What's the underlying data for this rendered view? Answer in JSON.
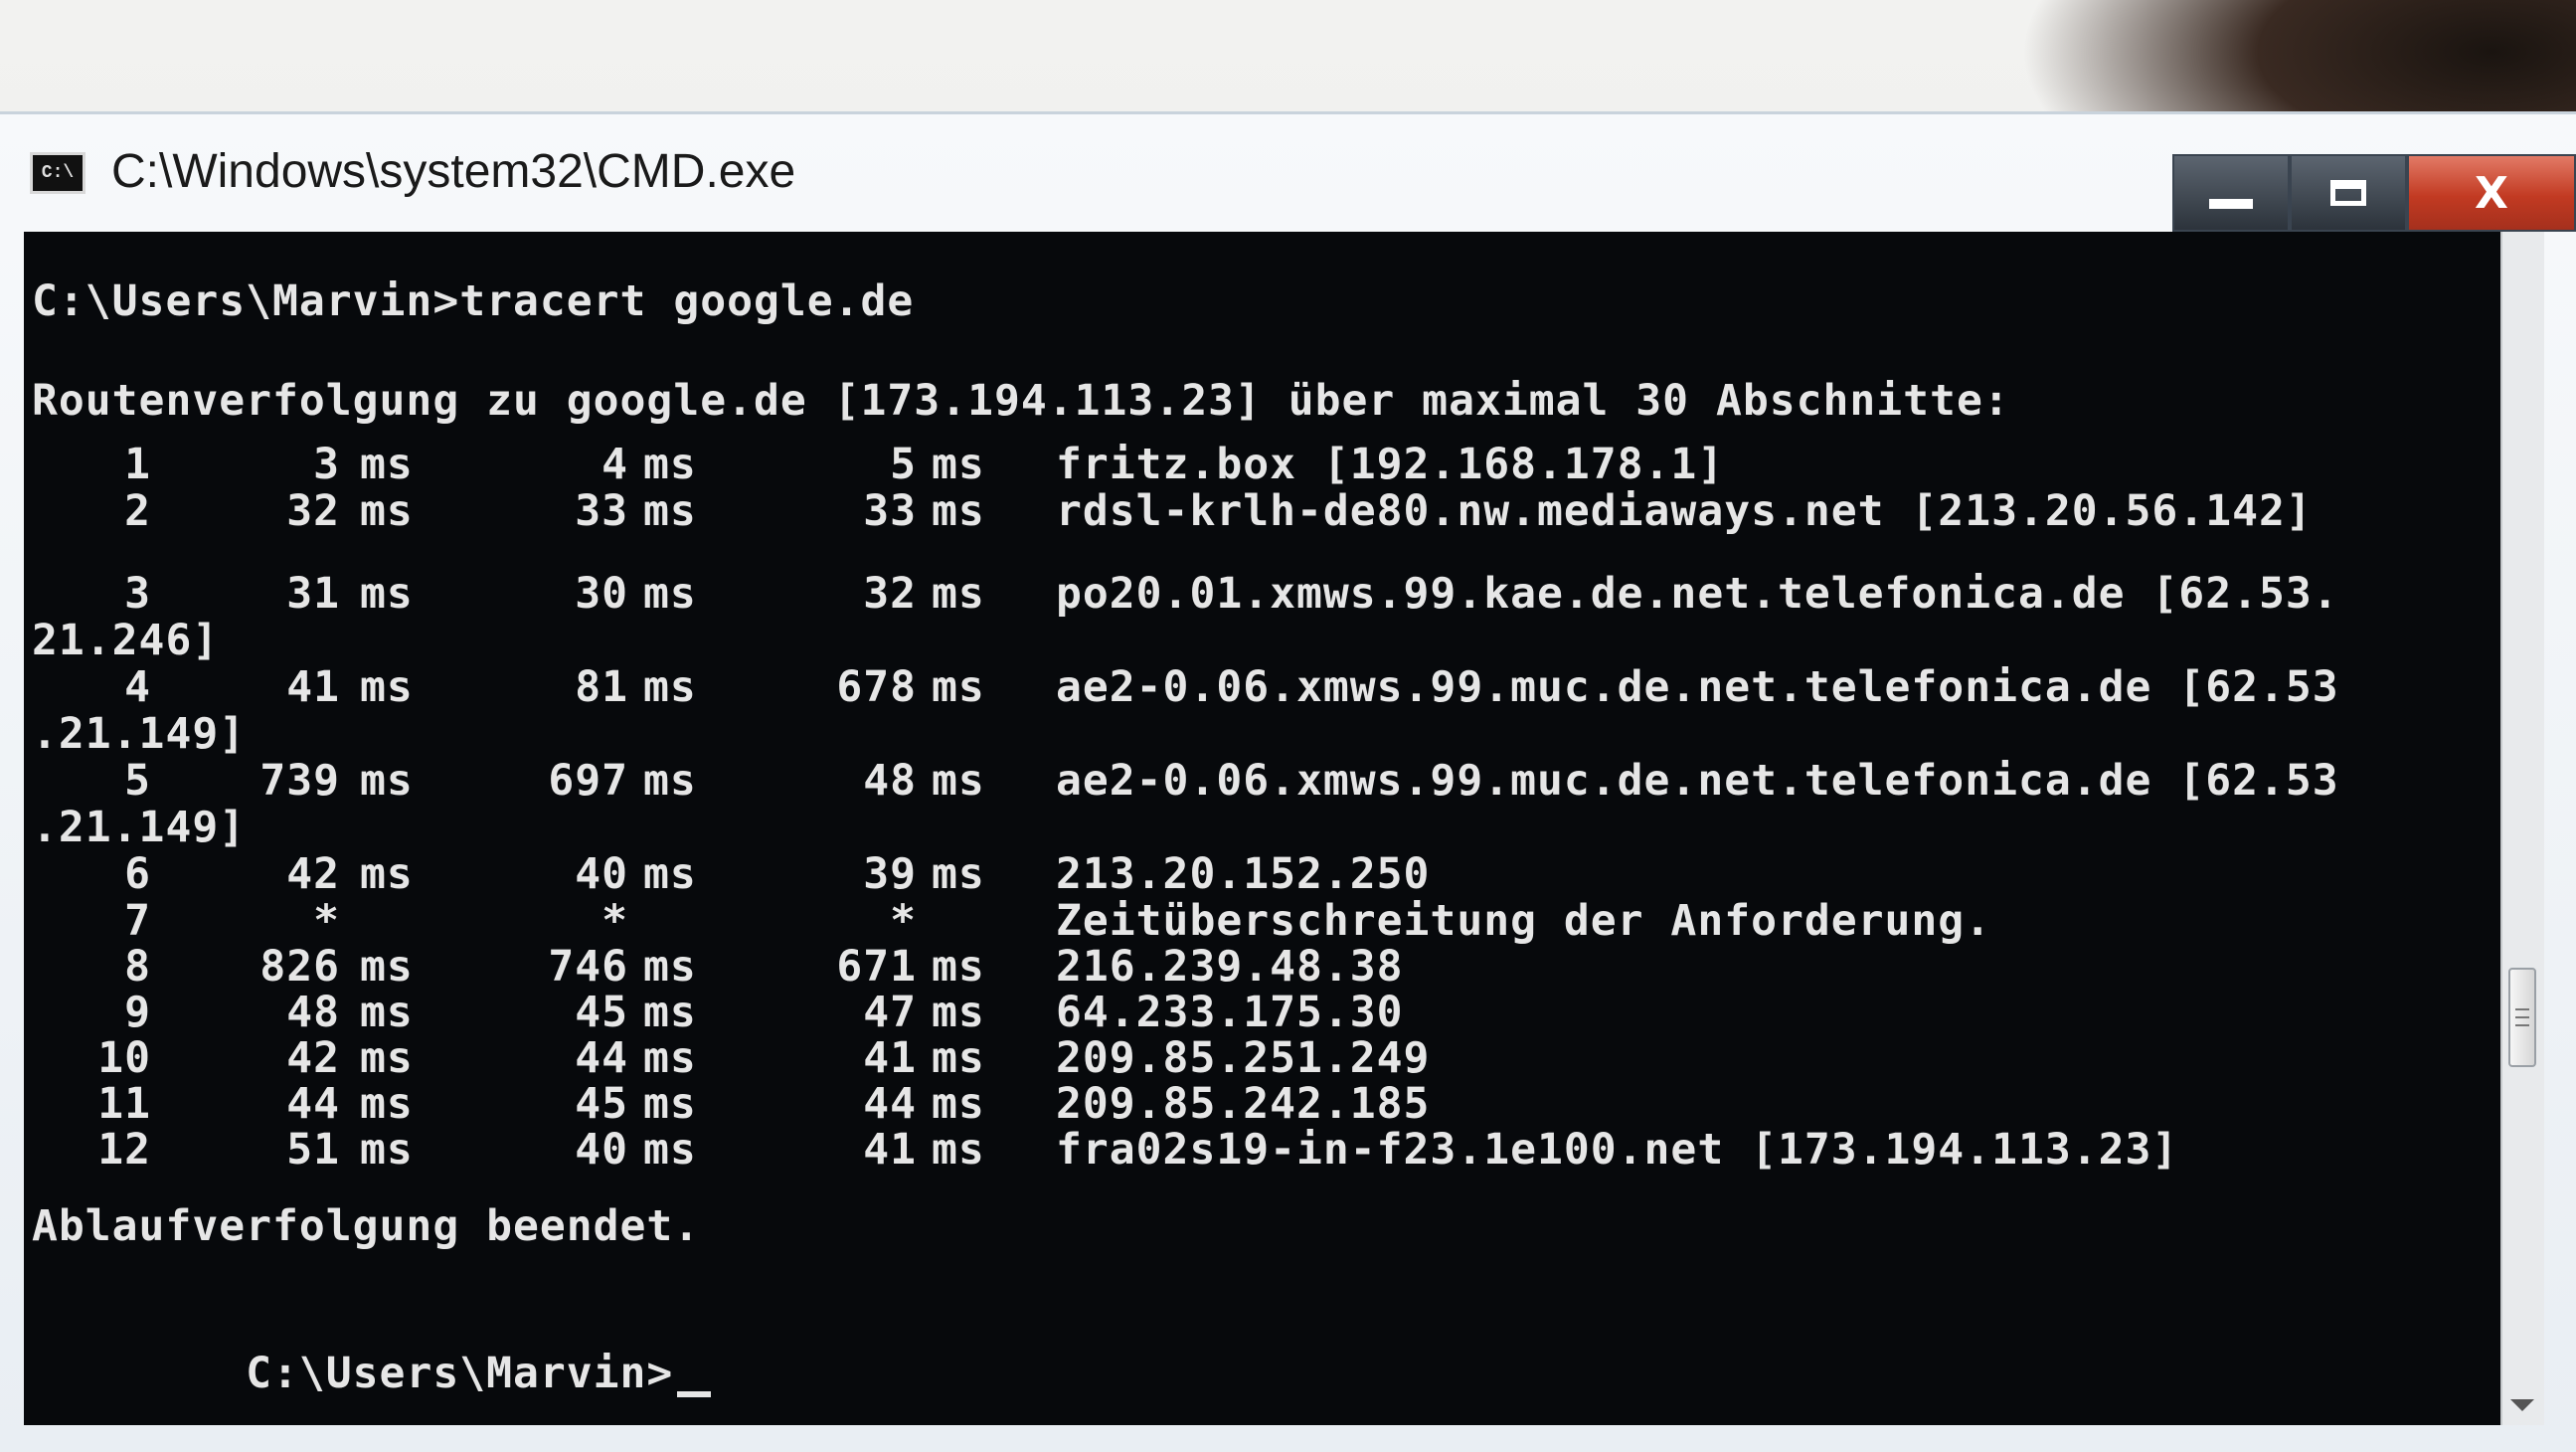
{
  "window": {
    "title": "C:\\Windows\\system32\\CMD.exe",
    "icon_text": "C:\\",
    "controls": {
      "minimize": "minimize-icon",
      "maximize": "maximize-icon",
      "close_label": "X"
    }
  },
  "console": {
    "command_line": "C:\\Users\\Marvin>tracert google.de",
    "header": "Routenverfolgung zu google.de [173.194.113.23] über maximal 30 Abschnitte:",
    "hops": [
      {
        "hop": "1",
        "t1": "3",
        "t2": "4",
        "t3": "5",
        "host": "fritz.box [192.168.178.1]",
        "cont": ""
      },
      {
        "hop": "2",
        "t1": "32",
        "t2": "33",
        "t3": "33",
        "host": "rdsl-krlh-de80.nw.mediaways.net [213.20.56.142]",
        "cont": ""
      },
      {
        "hop": "3",
        "t1": "31",
        "t2": "30",
        "t3": "32",
        "host": "po20.01.xmws.99.kae.de.net.telefonica.de [62.53.",
        "cont": "21.246]"
      },
      {
        "hop": "4",
        "t1": "41",
        "t2": "81",
        "t3": "678",
        "host": "ae2-0.06.xmws.99.muc.de.net.telefonica.de [62.53",
        "cont": ".21.149]"
      },
      {
        "hop": "5",
        "t1": "739",
        "t2": "697",
        "t3": "48",
        "host": "ae2-0.06.xmws.99.muc.de.net.telefonica.de [62.53",
        "cont": ".21.149]"
      },
      {
        "hop": "6",
        "t1": "42",
        "t2": "40",
        "t3": "39",
        "host": "213.20.152.250",
        "cont": ""
      },
      {
        "hop": "7",
        "t1": "*",
        "t2": "*",
        "t3": "*",
        "host": "Zeitüberschreitung der Anforderung.",
        "cont": ""
      },
      {
        "hop": "8",
        "t1": "826",
        "t2": "746",
        "t3": "671",
        "host": "216.239.48.38",
        "cont": ""
      },
      {
        "hop": "9",
        "t1": "48",
        "t2": "45",
        "t3": "47",
        "host": "64.233.175.30",
        "cont": ""
      },
      {
        "hop": "10",
        "t1": "42",
        "t2": "44",
        "t3": "41",
        "host": "209.85.251.249",
        "cont": ""
      },
      {
        "hop": "11",
        "t1": "44",
        "t2": "45",
        "t3": "44",
        "host": "209.85.242.185",
        "cont": ""
      },
      {
        "hop": "12",
        "t1": "51",
        "t2": "40",
        "t3": "41",
        "host": "fra02s19-in-f23.1e100.net [173.194.113.23]",
        "cont": ""
      }
    ],
    "unit": "ms",
    "footer": "Ablaufverfolgung beendet.",
    "prompt": "C:\\Users\\Marvin>"
  }
}
